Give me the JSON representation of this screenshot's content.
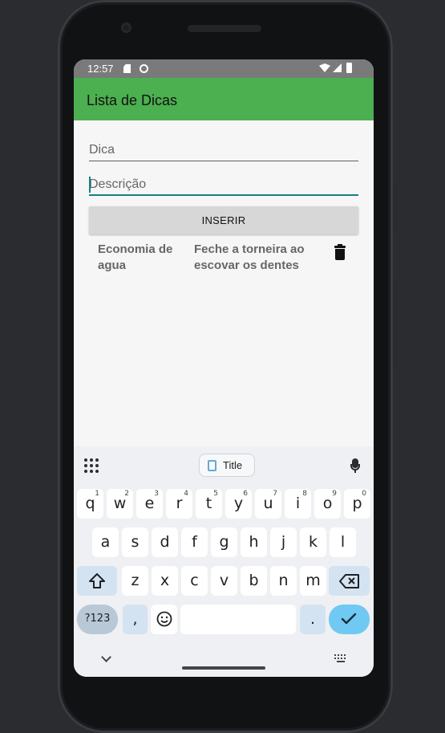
{
  "status_bar": {
    "time": "12:57",
    "icons": [
      "sd-card-icon",
      "circle-status-icon",
      "wifi-icon",
      "signal-icon",
      "battery-icon"
    ]
  },
  "app_bar": {
    "title": "Lista de Dicas",
    "color": "#4caf50"
  },
  "form": {
    "dica_placeholder": "Dica",
    "descricao_placeholder": "Descrição",
    "insert_button": "INSERIR"
  },
  "items": [
    {
      "title": "Economia de agua",
      "description": "Feche a torneira ao escovar os dentes"
    }
  ],
  "keyboard": {
    "chip_label": "Title",
    "row1": [
      {
        "k": "q",
        "n": "1"
      },
      {
        "k": "w",
        "n": "2"
      },
      {
        "k": "e",
        "n": "3"
      },
      {
        "k": "r",
        "n": "4"
      },
      {
        "k": "t",
        "n": "5"
      },
      {
        "k": "y",
        "n": "6"
      },
      {
        "k": "u",
        "n": "7"
      },
      {
        "k": "i",
        "n": "8"
      },
      {
        "k": "o",
        "n": "9"
      },
      {
        "k": "p",
        "n": "0"
      }
    ],
    "row2": [
      "a",
      "s",
      "d",
      "f",
      "g",
      "h",
      "j",
      "k",
      "l"
    ],
    "row3": [
      "z",
      "x",
      "c",
      "v",
      "b",
      "n",
      "m"
    ],
    "symbols_label": "?123",
    "comma": ",",
    "period": ".",
    "accent_color": "#6fc9f3"
  }
}
